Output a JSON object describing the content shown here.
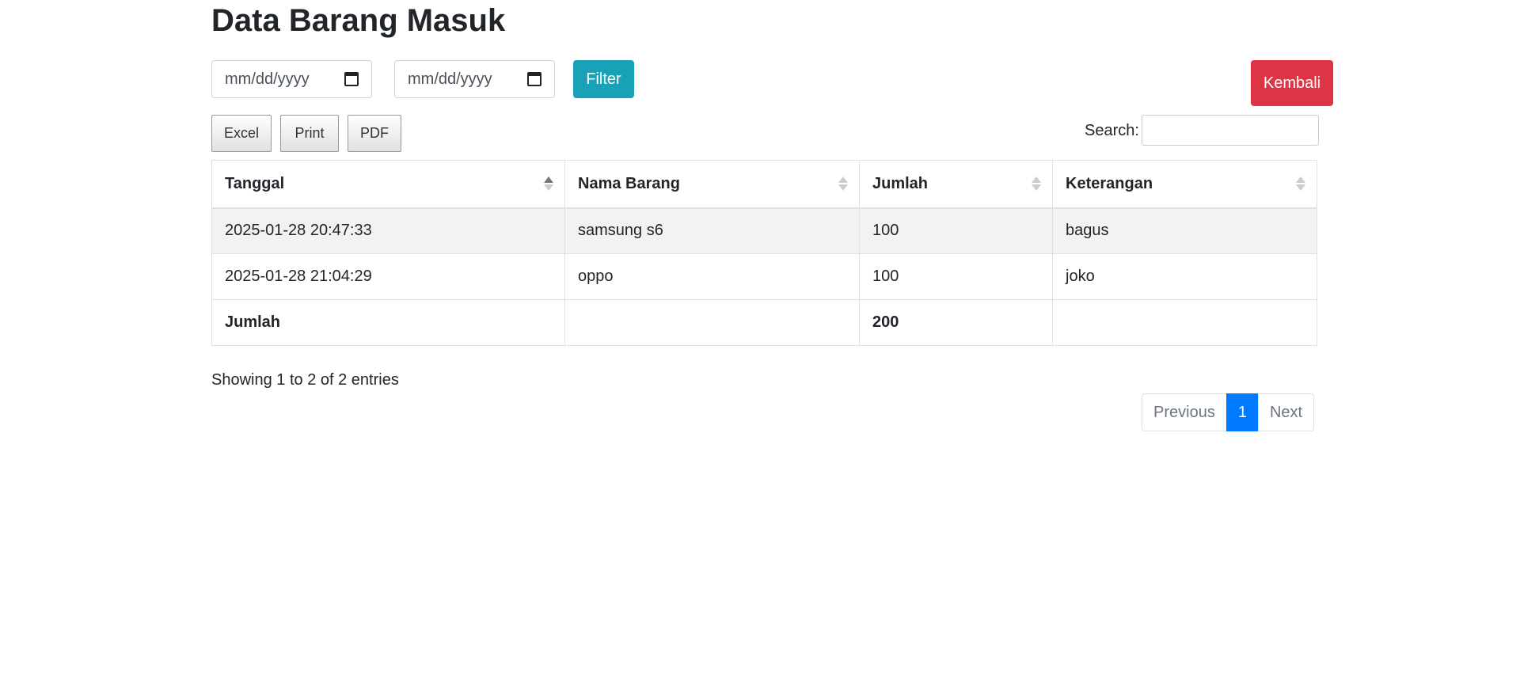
{
  "page": {
    "title": "Data Barang Masuk"
  },
  "filters": {
    "date_from_placeholder": "mm/dd/yyyy",
    "date_to_placeholder": "mm/dd/yyyy",
    "filter_label": "Filter",
    "back_label": "Kembali"
  },
  "export_buttons": {
    "excel": "Excel",
    "print": "Print",
    "pdf": "PDF"
  },
  "search": {
    "label": "Search:",
    "value": ""
  },
  "table": {
    "headers": [
      "Tanggal",
      "Nama Barang",
      "Jumlah",
      "Keterangan"
    ],
    "rows": [
      [
        "2025-01-28 20:47:33",
        "samsung s6",
        "100",
        "bagus"
      ],
      [
        "2025-01-28 21:04:29",
        "oppo",
        "100",
        "joko"
      ]
    ],
    "footer": [
      "Jumlah",
      "",
      "200",
      ""
    ]
  },
  "info": "Showing 1 to 2 of 2 entries",
  "pagination": {
    "previous": "Previous",
    "current": "1",
    "next": "Next"
  },
  "colors": {
    "filter": "#17a2b8",
    "back": "#dc3545",
    "active_page": "#007bff"
  }
}
